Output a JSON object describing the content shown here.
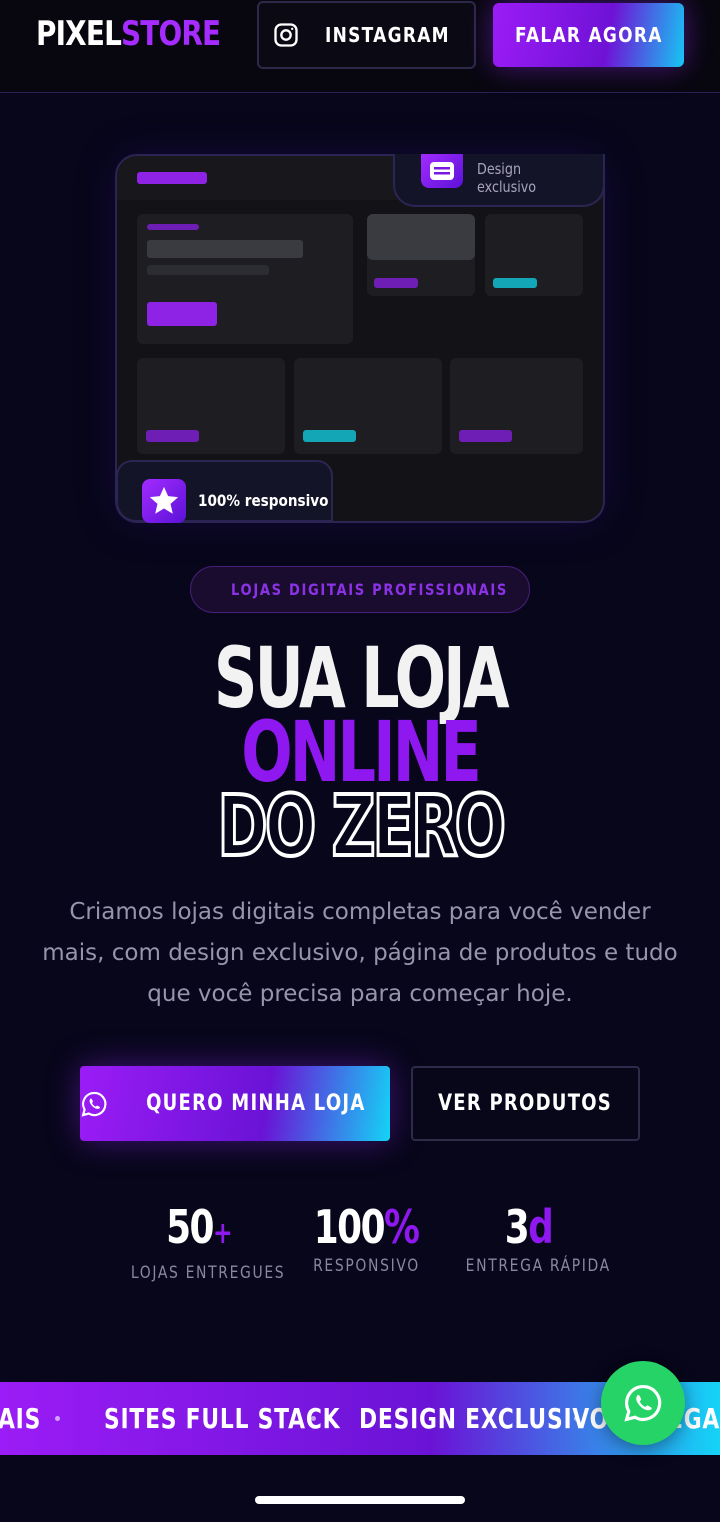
{
  "header": {
    "logo_part1": "PIXEL",
    "logo_part2": "STORE",
    "instagram_label": "INSTAGRAM",
    "talk_label": "FALAR AGORA"
  },
  "hero": {
    "badge_design": "Design exclusivo",
    "badge_responsive": "100% responsivo",
    "tag": "LOJAS DIGITAIS PROFISSIONAIS",
    "headline_line1": "SUA LOJA",
    "headline_line2": "ONLINE",
    "headline_line3": "DO ZERO",
    "lead": "Criamos lojas digitais completas para você vender mais, com design exclusivo, página de produtos e tudo que você precisa para começar hoje.",
    "cta_primary": "QUERO MINHA LOJA",
    "cta_secondary": "VER PRODUTOS"
  },
  "stats": [
    {
      "value": "50",
      "suffix": "+",
      "label": "LOJAS ENTREGUES"
    },
    {
      "value": "100",
      "suffix": "%",
      "label": "RESPONSIVO"
    },
    {
      "value": "3",
      "suffix": "d",
      "label": "ENTREGA RÁPIDA"
    }
  ],
  "ticker": {
    "item_left": "AIS",
    "item1": "SITES FULL STACK",
    "item2": "DESIGN EXCLUSIVO",
    "item_right": "EGA"
  },
  "colors": {
    "background": "#07061a",
    "accent_purple": "#8f17ef",
    "accent_cyan": "#14d4f6",
    "whatsapp_green": "#25d366"
  },
  "icons": {
    "instagram": "instagram-icon",
    "whatsapp": "whatsapp-icon",
    "star": "star-icon",
    "menu": "menu-lines-icon"
  }
}
